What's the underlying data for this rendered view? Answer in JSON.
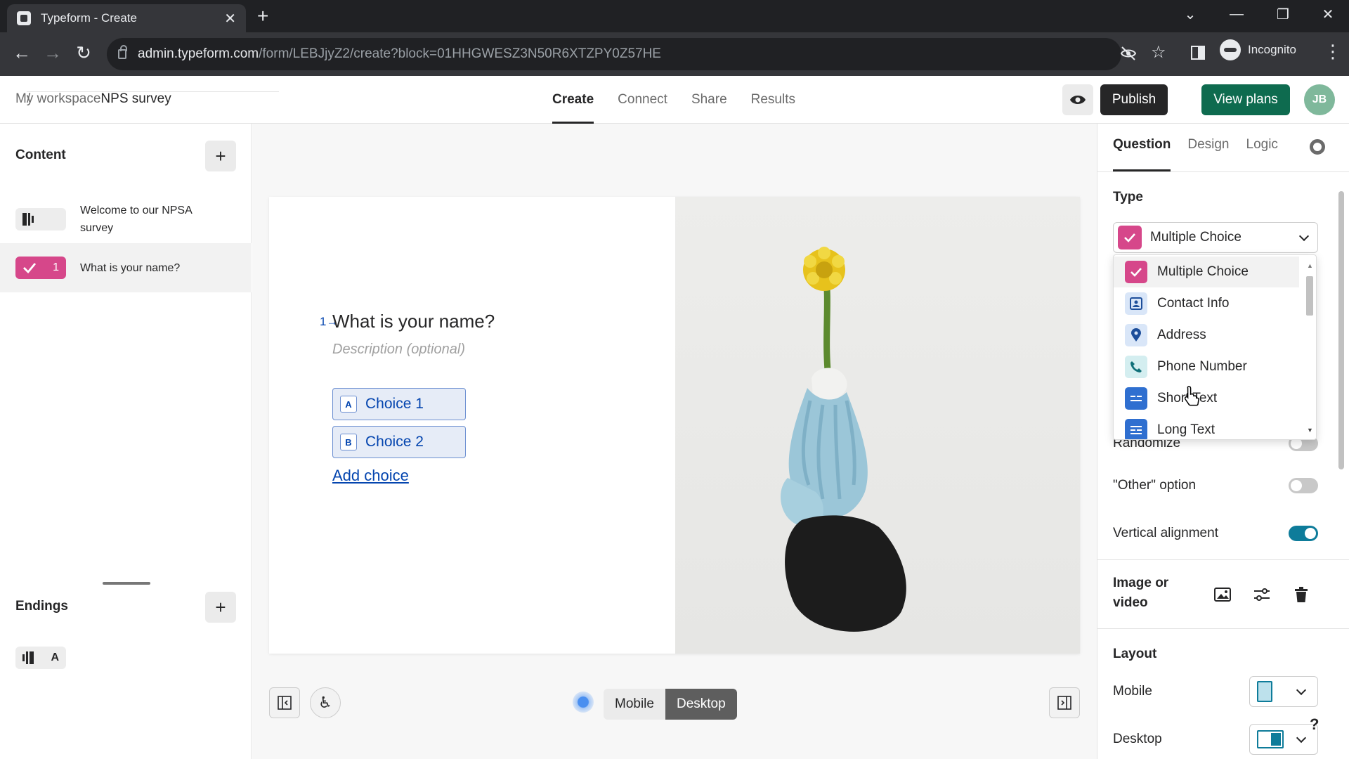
{
  "browser": {
    "tab_title": "Typeform - Create",
    "url_host": "admin.typeform.com",
    "url_path": "/form/LEBJjyZ2/create?block=01HHGWESZ3N50R6XTZPY0Z57HE",
    "profile_label": "Incognito"
  },
  "header": {
    "breadcrumb_root": "My workspace",
    "breadcrumb_sep": "/",
    "breadcrumb_current": "NPS survey",
    "tabs": [
      "Create",
      "Connect",
      "Share",
      "Results"
    ],
    "active_tab": "Create",
    "publish_label": "Publish",
    "view_plans_label": "View plans",
    "avatar_initials": "JB"
  },
  "left": {
    "content_title": "Content",
    "items": [
      {
        "label": "Welcome to our NPSA survey",
        "number": "",
        "icon": "welcome-screen-icon"
      },
      {
        "label": "What is your name?",
        "number": "1",
        "icon": "checkmark-icon",
        "color": "#d6478a"
      }
    ],
    "endings_title": "Endings",
    "ending_letter": "A"
  },
  "canvas": {
    "question_number": "1",
    "question_title": "What is your name?",
    "description_placeholder": "Description (optional)",
    "choices": [
      {
        "key": "A",
        "label": "Choice 1"
      },
      {
        "key": "B",
        "label": "Choice 2"
      }
    ],
    "add_choice_label": "Add choice",
    "view_toggle": [
      "Mobile",
      "Desktop"
    ],
    "active_view": "Desktop"
  },
  "right": {
    "tabs": [
      "Question",
      "Design",
      "Logic"
    ],
    "active_tab": "Question",
    "type_label": "Type",
    "type_value": "Multiple Choice",
    "type_options": [
      {
        "label": "Multiple Choice",
        "icon": "checkmark-icon",
        "color": "#d6478a"
      },
      {
        "label": "Contact Info",
        "icon": "contact-card-icon",
        "color": "#3b7ad9"
      },
      {
        "label": "Address",
        "icon": "location-pin-icon",
        "color": "#3b7ad9"
      },
      {
        "label": "Phone Number",
        "icon": "phone-icon",
        "color": "#0e8f9a"
      },
      {
        "label": "Short Text",
        "icon": "short-text-icon",
        "color": "#3b7ad9"
      },
      {
        "label": "Long Text",
        "icon": "long-text-icon",
        "color": "#3b7ad9"
      }
    ],
    "randomize_label": "Randomize",
    "other_option_label": "\"Other\" option",
    "vertical_alignment_label": "Vertical alignment",
    "image_or_video_label": "Image or video",
    "layout_label": "Layout",
    "mobile_label": "Mobile",
    "desktop_label": "Desktop",
    "help_label": "?"
  },
  "colors": {
    "accent_blue": "#0445af",
    "publish_bg": "#262627",
    "view_plans_bg": "#0e6b4f",
    "toggle_on": "#0e7c9a"
  }
}
